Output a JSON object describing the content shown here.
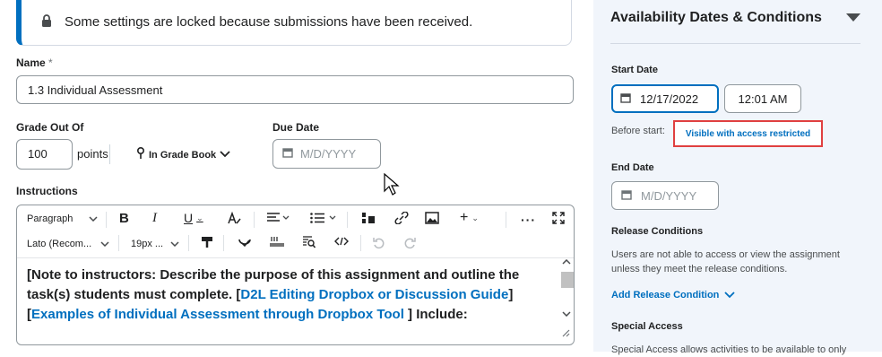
{
  "banner": {
    "icon": "lock-icon",
    "text": "Some settings are locked because submissions have been received."
  },
  "name": {
    "label": "Name",
    "required_mark": "*",
    "value": "1.3 Individual Assessment"
  },
  "grade": {
    "label": "Grade Out Of",
    "value": "100",
    "unit": "points",
    "gradebook_label": "In Grade Book"
  },
  "due_date": {
    "label": "Due Date",
    "placeholder": "M/D/YYYY"
  },
  "instructions": {
    "label": "Instructions",
    "toolbar": {
      "paragraph": "Paragraph",
      "font": "Lato (Recom...",
      "size": "19px ..."
    },
    "content": {
      "line1": "[Note to instructors: Describe the purpose of this assignment and outline the",
      "line2_prefix": "task(s) students must complete. [",
      "link1": "D2L Editing Dropbox or Discussion Guide",
      "line2_suffix": "]",
      "line3_prefix": "[",
      "link2": "Examples of Individual Assessment through Dropbox Tool",
      "line3_suffix": " ] Include:"
    }
  },
  "panel": {
    "title": "Availability Dates & Conditions",
    "start_date": {
      "label": "Start Date",
      "date": "12/17/2022",
      "time": "12:01 AM"
    },
    "before_start": {
      "label": "Before start:",
      "value": "Visible with access restricted"
    },
    "end_date": {
      "label": "End Date",
      "placeholder": "M/D/YYYY"
    },
    "release": {
      "label": "Release Conditions",
      "line1": "Users are not able to access or view the assignment",
      "line2": "unless they meet the release conditions.",
      "add_link": "Add Release Condition"
    },
    "special_access": {
      "label": "Special Access",
      "text": "Special Access allows activities to be available to only"
    }
  },
  "colors": {
    "accent": "#006fbf",
    "highlight": "#e04040",
    "panel_bg": "#f1f5fb"
  }
}
